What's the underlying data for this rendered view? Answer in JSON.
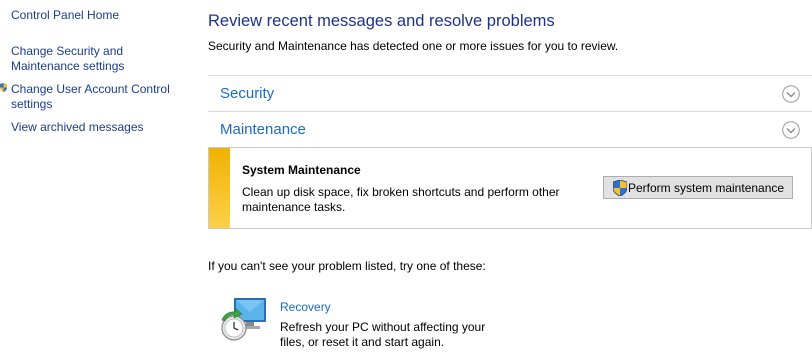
{
  "sidebar": {
    "items": [
      {
        "label": "Control Panel Home"
      },
      {
        "label": "Change Security and Maintenance settings"
      },
      {
        "label": "Change User Account Control settings"
      },
      {
        "label": "View archived messages"
      }
    ]
  },
  "main": {
    "title": "Review recent messages and resolve problems",
    "subtitle": "Security and Maintenance has detected one or more issues for you to review.",
    "sections": [
      {
        "label": "Security",
        "icon": "chevron-down-icon"
      },
      {
        "label": "Maintenance",
        "icon": "chevron-up-icon"
      }
    ],
    "message": {
      "title": "System Maintenance",
      "description": "Clean up disk space, fix broken shortcuts and perform other maintenance tasks.",
      "button_label": "Perform system maintenance",
      "stripe_color": "#f0b200"
    },
    "hint": "If you can't see your problem listed, try one of these:",
    "recovery": {
      "link": "Recovery",
      "description": "Refresh your PC without affecting your files, or reset it and start again."
    }
  },
  "colors": {
    "title": "#1e3287",
    "link": "#1b6ac9",
    "sidebar_link": "#1a3d8f",
    "divider": "#d9d9d9"
  }
}
